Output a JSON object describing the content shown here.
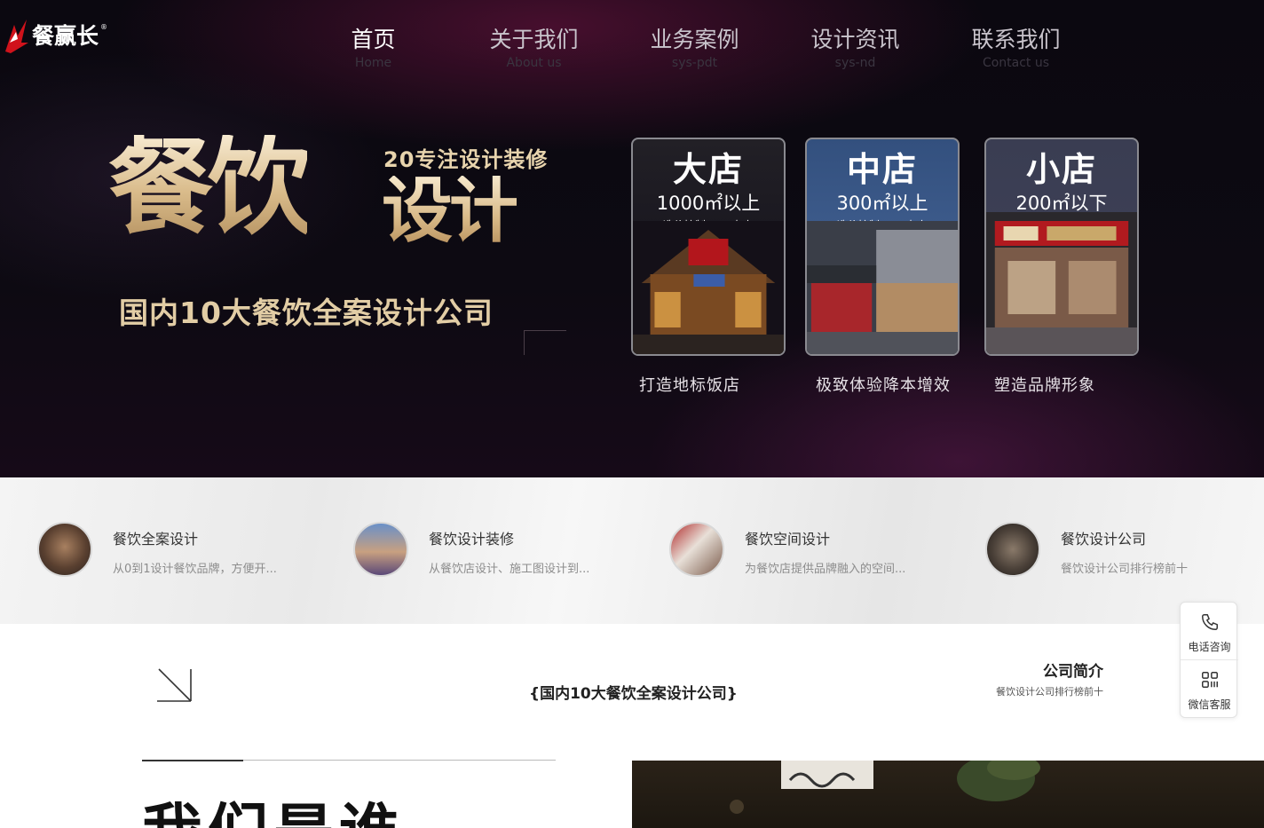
{
  "brand": {
    "name": "餐赢长",
    "reg": "®"
  },
  "nav": [
    {
      "label": "首页",
      "sub": "Home",
      "active": true
    },
    {
      "label": "关于我们",
      "sub": "About us"
    },
    {
      "label": "业务案例",
      "sub": "sys-pdt"
    },
    {
      "label": "设计资讯",
      "sub": "sys-nd"
    },
    {
      "label": "联系我们",
      "sub": "Contact us"
    }
  ],
  "hero": {
    "big_title": "餐饮",
    "badge": "20专注设计装修",
    "design": "设计",
    "slogan": "国内10大餐饮全案设计公司",
    "cards": [
      {
        "name": "大店",
        "area": "1000㎡以上",
        "cost": "造价控制1200左右",
        "caption": "打造地标饭店"
      },
      {
        "name": "中店",
        "area": "300㎡以上",
        "cost": "造价控制1000左右",
        "caption": "极致体验降本增效"
      },
      {
        "name": "小店",
        "area": "200㎡以下",
        "cost": "",
        "caption": "塑造品牌形象"
      }
    ]
  },
  "features": [
    {
      "title": "餐饮全案设计",
      "desc": "从0到1设计餐饮品牌，方便开..."
    },
    {
      "title": "餐饮设计装修",
      "desc": "从餐饮店设计、施工图设计到..."
    },
    {
      "title": "餐饮空间设计",
      "desc": "为餐饮店提供品牌融入的空间..."
    },
    {
      "title": "餐饮设计公司",
      "desc": "餐饮设计公司排行榜前十"
    }
  ],
  "section": {
    "mid_title": "{国内10大餐饮全案设计公司}",
    "intro_title": "公司简介",
    "intro_sub": "餐饮设计公司排行榜前十",
    "big_heading": "我们是谁"
  },
  "float": {
    "phone_label": "电话咨询",
    "wechat_label": "微信客服"
  },
  "colors": {
    "gold": "#e2cda5",
    "hero_bg": "#0b0810",
    "accent_red": "#d0121b"
  },
  "icons": [
    "logo-icon",
    "arrow-down-right-icon",
    "phone-icon",
    "wechat-grid-icon"
  ]
}
